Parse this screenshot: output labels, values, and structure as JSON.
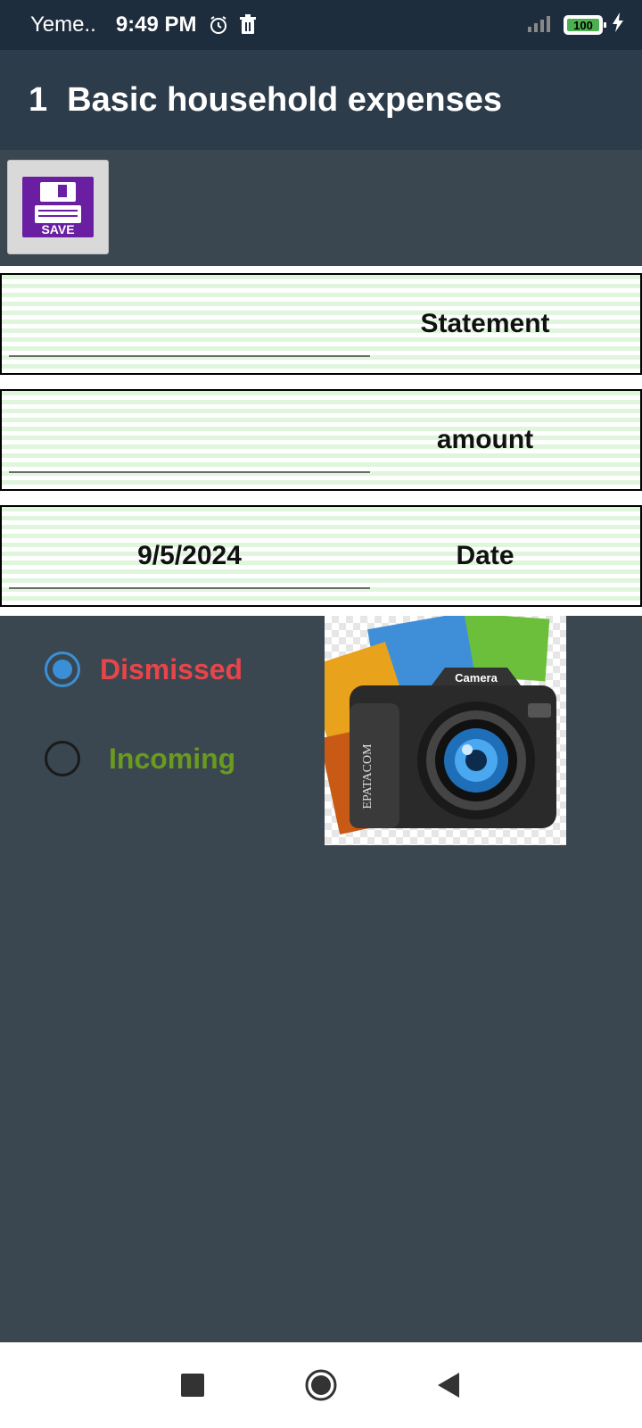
{
  "status_bar": {
    "carrier": "Yeme..",
    "time": "9:49 PM",
    "battery": "100",
    "icons": [
      "alarm-icon",
      "trash-icon",
      "signal-icon",
      "battery-icon",
      "charging-icon"
    ]
  },
  "header": {
    "number": "1",
    "title": "Basic household expenses"
  },
  "toolbar": {
    "save_label": "SAVE"
  },
  "form": {
    "statement": {
      "label": "Statement",
      "value": ""
    },
    "amount": {
      "label": "amount",
      "value": ""
    },
    "date": {
      "label": "Date",
      "value": "9/5/2024"
    }
  },
  "type_options": [
    {
      "label": "Dismissed",
      "checked": true,
      "color": "#e8454a"
    },
    {
      "label": "Incoming",
      "checked": false,
      "color": "#6a9a1f"
    }
  ],
  "camera": {
    "top_label": "Camera",
    "brand_label": "EPATACOM"
  },
  "colors": {
    "status_bar": "#1e2d3d",
    "title_bar": "#2d3c4a",
    "background": "#3a4750",
    "radio_accent": "#3b8fd6",
    "save_icon": "#6a1fa3"
  }
}
